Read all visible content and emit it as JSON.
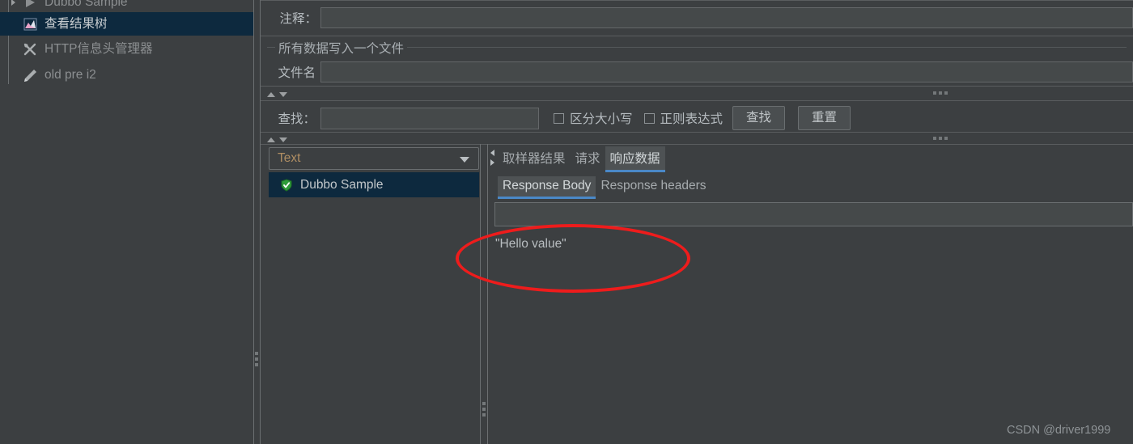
{
  "tree": {
    "items": [
      {
        "label": "Dubbo Sample",
        "icon": "arrow-right-icon",
        "selected": false,
        "dim": false,
        "partial": true
      },
      {
        "label": "查看结果树",
        "icon": "view-results-tree-icon",
        "selected": true,
        "dim": false,
        "partial": false
      },
      {
        "label": "HTTP信息头管理器",
        "icon": "header-manager-icon",
        "selected": false,
        "dim": true,
        "partial": false
      },
      {
        "label": "old pre i2",
        "icon": "pencil-icon",
        "selected": false,
        "dim": true,
        "partial": false
      }
    ]
  },
  "form": {
    "comment_label": "注释：",
    "comment_value": "",
    "group_title": "所有数据写入一个文件",
    "filename_label": "文件名",
    "filename_value": ""
  },
  "search": {
    "label": "查找：",
    "value": "",
    "case_sensitive_label": "区分大小写",
    "case_sensitive_checked": false,
    "regex_label": "正则表达式",
    "regex_checked": false,
    "find_button": "查找",
    "reset_button": "重置"
  },
  "results": {
    "renderer_selected": "Text",
    "items": [
      {
        "label": "Dubbo Sample",
        "icon": "shield-success-icon",
        "selected": true
      }
    ]
  },
  "detail": {
    "top_tabs": [
      {
        "label": "取样器结果",
        "active": false
      },
      {
        "label": "请求",
        "active": false
      },
      {
        "label": "响应数据",
        "active": true
      }
    ],
    "sub_tabs": [
      {
        "label": "Response Body",
        "active": true
      },
      {
        "label": "Response headers",
        "active": false
      }
    ],
    "response_search_value": "",
    "response_body": "\"Hello value\""
  },
  "watermark": "CSDN @driver1999",
  "colors": {
    "background": "#3c3f41",
    "selection": "#0d293e",
    "accent": "#4a88c7",
    "annotation": "#ee1c1c",
    "combo_text": "#b08e63"
  }
}
